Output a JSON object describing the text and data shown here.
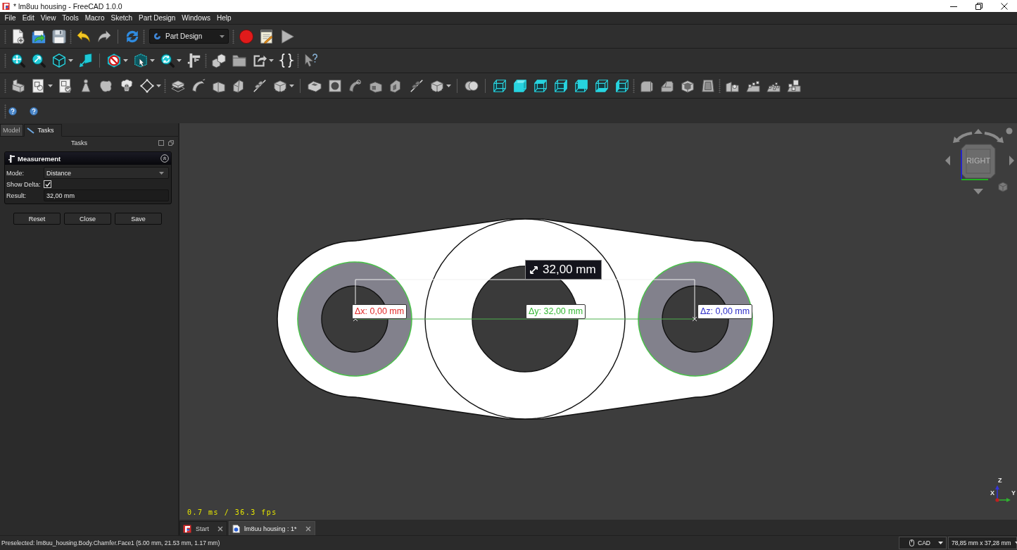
{
  "window": {
    "title": "* lm8uu housing - FreeCAD 1.0.0"
  },
  "menu_bar": [
    "File",
    "Edit",
    "View",
    "Tools",
    "Macro",
    "Sketch",
    "Part Design",
    "Windows",
    "Help"
  ],
  "workbench_selector": {
    "value": "Part Design"
  },
  "combo_view": {
    "tabs": [
      {
        "label": "Model",
        "selected": false
      },
      {
        "label": "Tasks",
        "selected": true
      }
    ],
    "title": "Tasks",
    "task_panel": {
      "title": "Measurement",
      "rows": [
        {
          "kind": "dropdown",
          "label": "Mode:",
          "value": "Distance"
        },
        {
          "kind": "checkbox",
          "label": "Show Delta:",
          "checked": true
        },
        {
          "kind": "text",
          "label": "Result:",
          "value": "32,00 mm"
        }
      ]
    },
    "buttons": [
      "Reset",
      "Close",
      "Save"
    ]
  },
  "viewport": {
    "distance_label": "32,00 mm",
    "delta_labels": [
      {
        "text": "Δx: 0,00 mm",
        "color": "#e02828"
      },
      {
        "text": "Δy: 32,00 mm",
        "color": "#34b834"
      },
      {
        "text": "Δz: 0,00 mm",
        "color": "#2c2cc8"
      }
    ],
    "navigation_cube": {
      "face": "RIGHT"
    },
    "axis_labels": [
      "Z",
      "X",
      "Y"
    ],
    "frame_stats": "0.7 ms / 36.3 fps"
  },
  "document_tabs": [
    {
      "label": "Start",
      "selected": false
    },
    {
      "label": "lm8uu housing : 1*",
      "selected": true
    }
  ],
  "status_bar": {
    "message": "Preselected: lm8uu_housing.Body.Chamfer.Face1 (5.00 mm, 21.53 mm, 1.17 mm)",
    "navigation_style": "CAD",
    "view_size": "78,85 mm x 37,28 mm"
  }
}
